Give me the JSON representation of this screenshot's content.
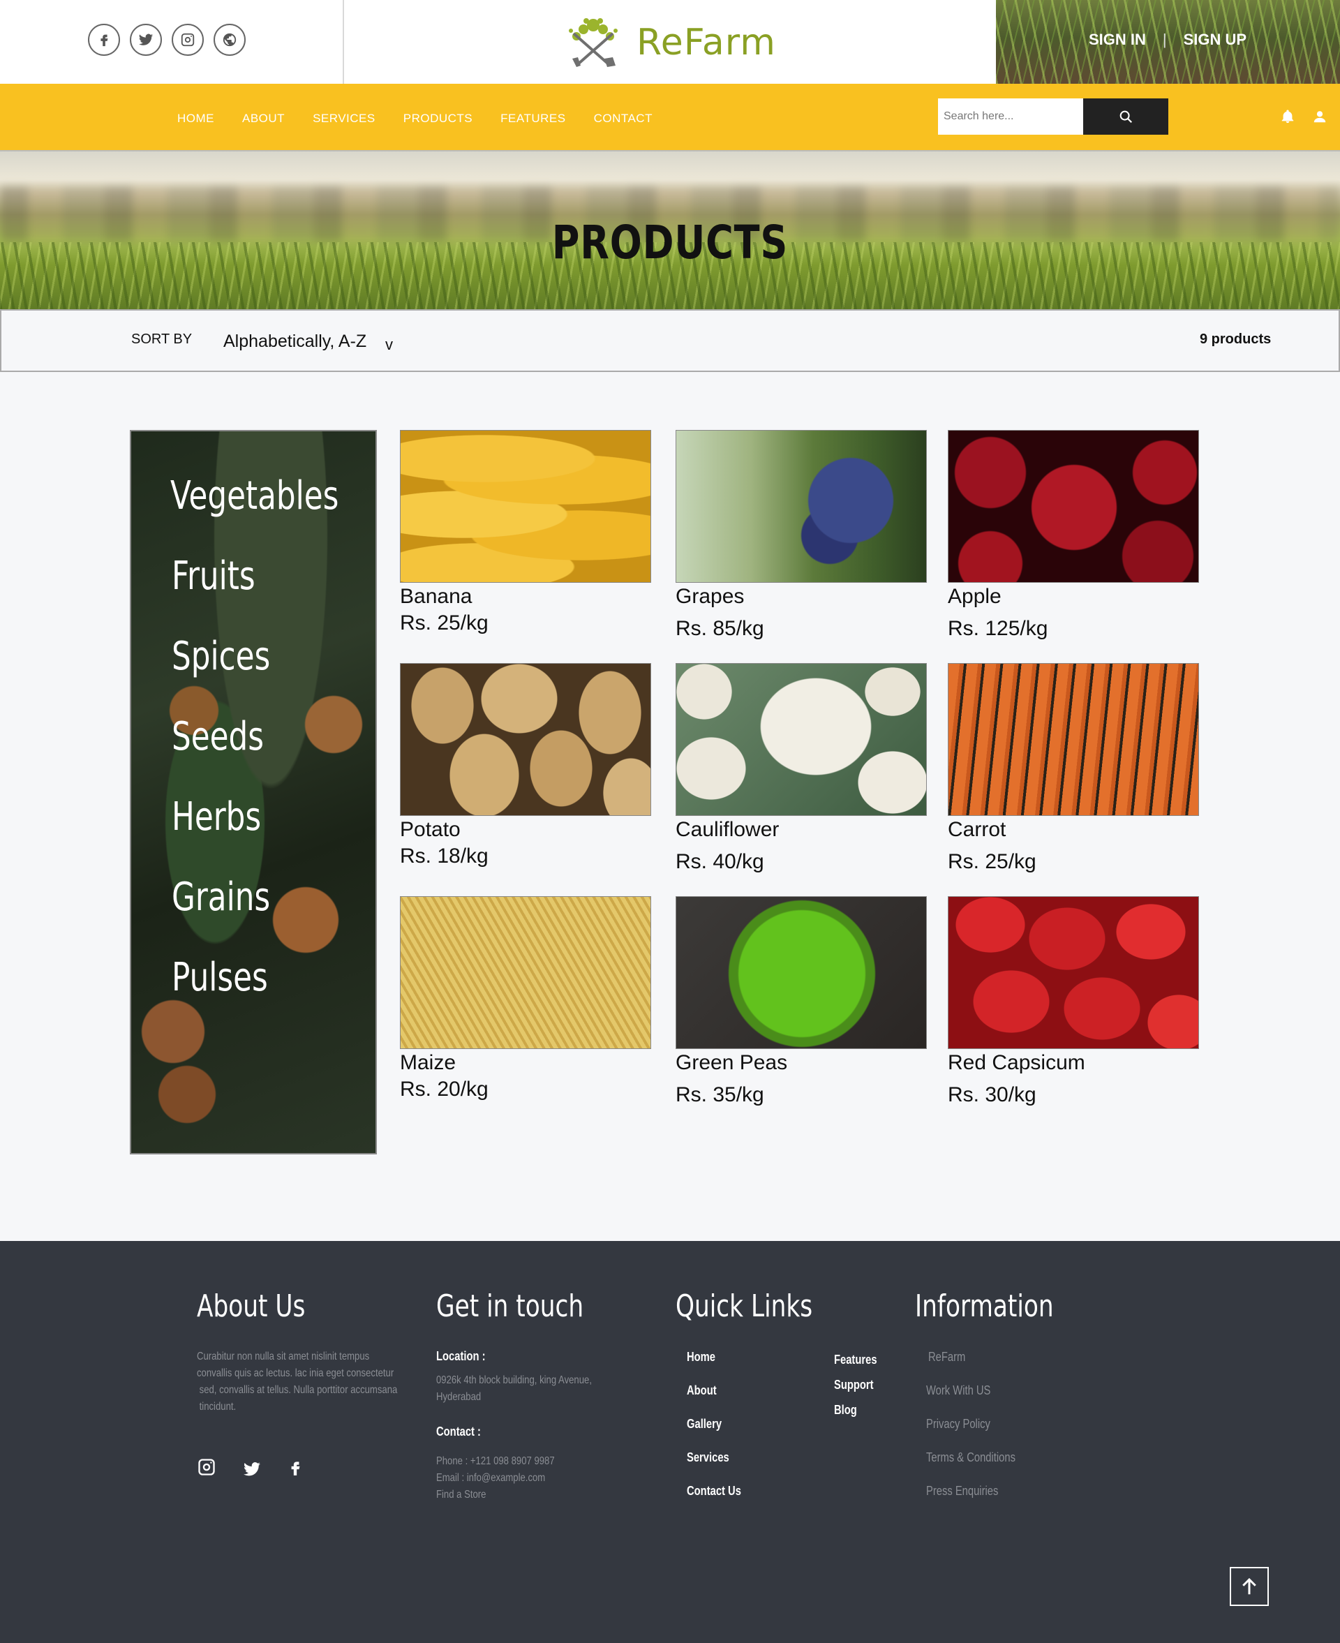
{
  "header": {
    "social": [
      "facebook-icon",
      "twitter-icon",
      "instagram-icon",
      "globe-icon"
    ],
    "brand": {
      "name": "ReFarm",
      "accent": "#8aa024"
    },
    "auth": {
      "sign_in": "SIGN IN",
      "separator": "|",
      "sign_up": "SIGN UP"
    }
  },
  "nav": {
    "color": "#f9c120",
    "items": [
      "HOME",
      "ABOUT",
      "SERVICES",
      "PRODUCTS",
      "FEATURES",
      "CONTACT"
    ],
    "search": {
      "placeholder": "Search here..."
    },
    "icons": [
      "bell-icon",
      "user-icon"
    ]
  },
  "hero": {
    "title": "PRODUCTS"
  },
  "sort": {
    "label": "SORT BY",
    "value": "Alphabetically, A-Z",
    "chevron": "v",
    "count": "9 products"
  },
  "categories": [
    "Vegetables",
    "Fruits",
    "Spices",
    "Seeds",
    "Herbs",
    "Grains",
    "Pulses"
  ],
  "products": [
    {
      "name": "Banana",
      "price": "Rs. 25/kg"
    },
    {
      "name": "Grapes",
      "price": "Rs. 85/kg"
    },
    {
      "name": "Apple",
      "price": "Rs. 125/kg"
    },
    {
      "name": "Potato",
      "price": "Rs. 18/kg"
    },
    {
      "name": "Cauliflower",
      "price": "Rs. 40/kg"
    },
    {
      "name": "Carrot",
      "price": "Rs. 25/kg"
    },
    {
      "name": "Maize",
      "price": "Rs. 20/kg"
    },
    {
      "name": "Green Peas",
      "price": "Rs. 35/kg"
    },
    {
      "name": "Red Capsicum",
      "price": "Rs. 30/kg"
    }
  ],
  "footer": {
    "background": "#343840",
    "about": {
      "title": "About Us",
      "text": [
        "Curabitur non nulla sit amet nislinit tempus",
        "convallis quis ac lectus. lac inia eget consectetur",
        " sed, convallis at tellus. Nulla porttitor accumsana",
        " tincidunt."
      ],
      "social": [
        "instagram-icon",
        "twitter-icon",
        "facebook-icon"
      ]
    },
    "contact": {
      "title": "Get in touch",
      "location_label": "Location :",
      "location": [
        "0926k 4th block building, king Avenue,",
        "Hyderabad"
      ],
      "contact_label": "Contact :",
      "phone": "Phone : +121 098 8907 9987",
      "email": "Email : info@example.com",
      "store": "Find a Store"
    },
    "quick_links": {
      "title": "Quick Links",
      "col1": [
        "Home",
        "About",
        "Gallery",
        "Services",
        "Contact Us"
      ],
      "col2": [
        "Features",
        "Support",
        "Blog"
      ]
    },
    "information": {
      "title": "Information",
      "items": [
        "ReFarm",
        "Work With US",
        "Privacy Policy",
        "Terms & Conditions",
        "Press Enquiries"
      ]
    },
    "to_top": "arrow-up-icon"
  }
}
